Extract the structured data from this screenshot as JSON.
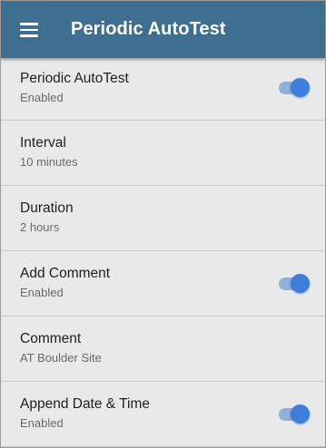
{
  "app_bar": {
    "title": "Periodic AutoTest",
    "menu_icon": "hamburger-menu-icon",
    "background_color": "#3e6f91"
  },
  "settings": [
    {
      "title": "Periodic AutoTest",
      "subtitle": "Enabled",
      "toggle": true
    },
    {
      "title": "Interval",
      "subtitle": "10 minutes",
      "toggle": null
    },
    {
      "title": "Duration",
      "subtitle": "2 hours",
      "toggle": null
    },
    {
      "title": "Add Comment",
      "subtitle": "Enabled",
      "toggle": true
    },
    {
      "title": "Comment",
      "subtitle": "AT Boulder Site",
      "toggle": null
    },
    {
      "title": "Append Date & Time",
      "subtitle": "Enabled",
      "toggle": true
    }
  ],
  "colors": {
    "toggle_on_thumb": "#3d7fdb",
    "toggle_on_track": "#8fb0d9",
    "list_background": "#e9e9e9"
  }
}
